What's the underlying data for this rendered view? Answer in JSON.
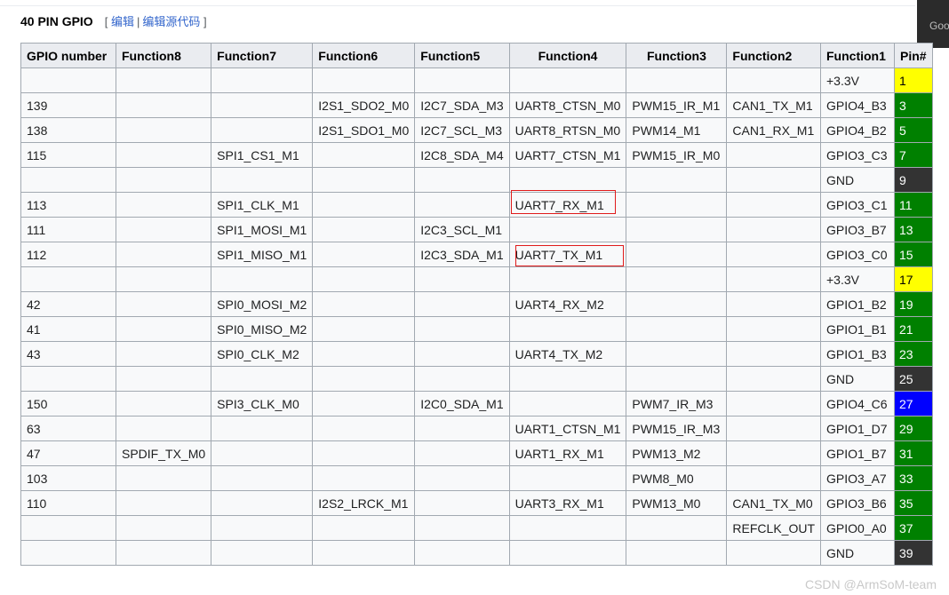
{
  "heading": {
    "title": "40 PIN GPIO",
    "open_bracket": "[",
    "edit_label": "编辑",
    "separator": "|",
    "edit_source_label": "编辑源代码",
    "close_bracket": "]"
  },
  "corner_tab": {
    "text": "Goo"
  },
  "table": {
    "headers": [
      "GPIO number",
      "Function8",
      "Function7",
      "Function6",
      "Function5",
      "Function4",
      "Function3",
      "Function2",
      "Function1",
      "Pin#"
    ],
    "rows": [
      [
        "",
        "",
        "",
        "",
        "",
        "",
        "",
        "",
        "+3.3V",
        "1"
      ],
      [
        "139",
        "",
        "",
        "I2S1_SDO2_M0",
        "I2C7_SDA_M3",
        "UART8_CTSN_M0",
        "PWM15_IR_M1",
        "CAN1_TX_M1",
        "GPIO4_B3",
        "3"
      ],
      [
        "138",
        "",
        "",
        "I2S1_SDO1_M0",
        "I2C7_SCL_M3",
        "UART8_RTSN_M0",
        "PWM14_M1",
        "CAN1_RX_M1",
        "GPIO4_B2",
        "5"
      ],
      [
        "115",
        "",
        "SPI1_CS1_M1",
        "",
        "I2C8_SDA_M4",
        "UART7_CTSN_M1",
        "PWM15_IR_M0",
        "",
        "GPIO3_C3",
        "7"
      ],
      [
        "",
        "",
        "",
        "",
        "",
        "",
        "",
        "",
        "GND",
        "9"
      ],
      [
        "113",
        "",
        "SPI1_CLK_M1",
        "",
        "",
        "UART7_RX_M1",
        "",
        "",
        "GPIO3_C1",
        "11"
      ],
      [
        "111",
        "",
        "SPI1_MOSI_M1",
        "",
        "I2C3_SCL_M1",
        "",
        "",
        "",
        "GPIO3_B7",
        "13"
      ],
      [
        "112",
        "",
        "SPI1_MISO_M1",
        "",
        "I2C3_SDA_M1",
        "UART7_TX_M1",
        "",
        "",
        "GPIO3_C0",
        "15"
      ],
      [
        "",
        "",
        "",
        "",
        "",
        "",
        "",
        "",
        "+3.3V",
        "17"
      ],
      [
        "42",
        "",
        "SPI0_MOSI_M2",
        "",
        "",
        "UART4_RX_M2",
        "",
        "",
        "GPIO1_B2",
        "19"
      ],
      [
        "41",
        "",
        "SPI0_MISO_M2",
        "",
        "",
        "",
        "",
        "",
        "GPIO1_B1",
        "21"
      ],
      [
        "43",
        "",
        "SPI0_CLK_M2",
        "",
        "",
        "UART4_TX_M2",
        "",
        "",
        "GPIO1_B3",
        "23"
      ],
      [
        "",
        "",
        "",
        "",
        "",
        "",
        "",
        "",
        "GND",
        "25"
      ],
      [
        "150",
        "",
        "SPI3_CLK_M0",
        "",
        "I2C0_SDA_M1",
        "",
        "PWM7_IR_M3",
        "",
        "GPIO4_C6",
        "27"
      ],
      [
        "63",
        "",
        "",
        "",
        "",
        "UART1_CTSN_M1",
        "PWM15_IR_M3",
        "",
        "GPIO1_D7",
        "29"
      ],
      [
        "47",
        "SPDIF_TX_M0",
        "",
        "",
        "",
        "UART1_RX_M1",
        "PWM13_M2",
        "",
        "GPIO1_B7",
        "31"
      ],
      [
        "103",
        "",
        "",
        "",
        "",
        "",
        "PWM8_M0",
        "",
        "GPIO3_A7",
        "33"
      ],
      [
        "110",
        "",
        "",
        "I2S2_LRCK_M1",
        "",
        "UART3_RX_M1",
        "PWM13_M0",
        "CAN1_TX_M0",
        "GPIO3_B6",
        "35"
      ],
      [
        "",
        "",
        "",
        "",
        "",
        "",
        "",
        "REFCLK_OUT",
        "GPIO0_A0",
        "37"
      ],
      [
        "",
        "",
        "",
        "",
        "",
        "",
        "",
        "",
        "GND",
        "39"
      ]
    ],
    "pin_colors": [
      "yellow",
      "green",
      "green",
      "green",
      "black",
      "green",
      "green",
      "green",
      "yellow",
      "green",
      "green",
      "green",
      "black",
      "blue",
      "green",
      "green",
      "green",
      "green",
      "green",
      "black"
    ],
    "highlighted_cells": [
      {
        "row": 5,
        "col": 5,
        "text": "UART7_RX_M1"
      },
      {
        "row": 7,
        "col": 5,
        "text": "UART7_TX_M1"
      }
    ]
  },
  "colors": {
    "yellow": "#ffff00",
    "green": "#008000",
    "black": "#333333",
    "blue": "#0000ff",
    "highlight": "#e01b1b",
    "link": "#3366cc"
  },
  "watermark": {
    "text": "CSDN @ArmSoM-team"
  }
}
